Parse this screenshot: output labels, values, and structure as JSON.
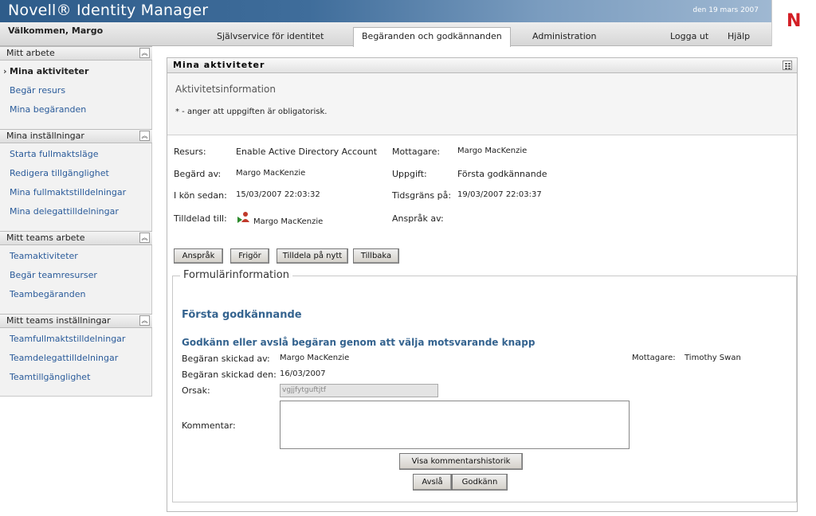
{
  "header": {
    "app_title": "Novell® Identity Manager",
    "date": "den 19 mars 2007",
    "welcome": "Välkommen, Margo",
    "logo_letter": "N"
  },
  "nav": {
    "tabs": [
      {
        "label": "Självservice för identitet",
        "active": false
      },
      {
        "label": "Begäranden och godkännanden",
        "active": true
      },
      {
        "label": "Administration",
        "active": false
      }
    ],
    "logout": "Logga ut",
    "help": "Hjälp"
  },
  "sidebar": {
    "sections": [
      {
        "title": "Mitt arbete",
        "items": [
          "Mina aktiviteter",
          "Begär resurs",
          "Mina begäranden"
        ]
      },
      {
        "title": "Mina inställningar",
        "items": [
          "Starta fullmaktsläge",
          "Redigera tillgänglighet",
          "Mina fullmaktstilldelningar",
          "Mina delegattilldelningar"
        ]
      },
      {
        "title": "Mitt teams arbete",
        "items": [
          "Teamaktiviteter",
          "Begär teamresurser",
          "Teambegäranden"
        ]
      },
      {
        "title": "Mitt teams inställningar",
        "items": [
          "Teamfullmaktstilldelningar",
          "Teamdelegattilldelningar",
          "Teamtillgänglighet"
        ]
      }
    ],
    "current_item": "Mina aktiviteter"
  },
  "main": {
    "panel_title": "Mina aktiviteter",
    "info_heading": "Aktivitetsinformation",
    "required_note": "* - anger att uppgiften är obligatorisk.",
    "details": {
      "resurs_label": "Resurs:",
      "resurs_value": "Enable Active Directory Account",
      "mottagare_label": "Mottagare:",
      "mottagare_value": "Margo MacKenzie",
      "begard_av_label": "Begärd av:",
      "begard_av_value": "Margo MacKenzie",
      "uppgift_label": "Uppgift:",
      "uppgift_value": "Första godkännande",
      "i_kon_label": "I kön sedan:",
      "i_kon_value": "15/03/2007 22:03:32",
      "tidsgrans_label": "Tidsgräns på:",
      "tidsgrans_value": "19/03/2007 22:03:37",
      "tilldelad_label": "Tilldelad till:",
      "tilldelad_value": "Margo MacKenzie",
      "anspråk_av_label": "Anspråk av:"
    },
    "buttons": {
      "claim": "Anspråk",
      "release": "Frigör",
      "reassign": "Tilldela på nytt",
      "back": "Tillbaka"
    },
    "form": {
      "legend": "Formulärinformation",
      "title": "Första godkännande",
      "subtitle": "Godkänn eller avslå begäran genom att välja motsvarande knapp",
      "sent_by_label": "Begäran skickad av:",
      "sent_by_value": "Margo MacKenzie",
      "recipient_label": "Mottagare:",
      "recipient_value": "Timothy Swan",
      "sent_date_label": "Begäran skickad den:",
      "sent_date_value": "16/03/2007",
      "reason_label": "Orsak:",
      "reason_value": "vgjjfytguftjtf",
      "comment_label": "Kommentar:",
      "comment_value": "",
      "history_button": "Visa kommentarshistorik",
      "deny_button": "Avslå",
      "approve_button": "Godkänn"
    }
  },
  "colors": {
    "banner": "#2e5c8a",
    "link": "#2a5b9a",
    "form_title": "#34638f",
    "logo": "#d31e25"
  }
}
